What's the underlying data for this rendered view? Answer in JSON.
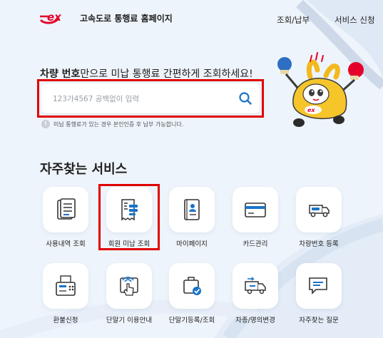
{
  "header": {
    "site_title": "고속도로 통행료 홈페이지",
    "nav": [
      "조회/납부",
      "서비스 신청"
    ]
  },
  "search": {
    "headline_bold": "차량 번호",
    "headline_rest": "만으로 미납 통행료 간편하게 조회하세요!",
    "placeholder": "123가4567 공백없이 입력",
    "notice": "미납 통행료가 있는 경우 본인인증 후 납부 가능합니다."
  },
  "services": {
    "title": "자주찾는 서비스",
    "items": [
      {
        "label": "사용내역 조회",
        "icon": "document-list-icon"
      },
      {
        "label": "회원 미납 조회",
        "icon": "receipt-icon"
      },
      {
        "label": "마이페이지",
        "icon": "profile-book-icon"
      },
      {
        "label": "카드관리",
        "icon": "credit-card-icon"
      },
      {
        "label": "차량번호 등록",
        "icon": "vehicle-icon"
      },
      {
        "label": "환불신청",
        "icon": "fax-machine-icon"
      },
      {
        "label": "단말기 이용안내",
        "icon": "tap-terminal-icon"
      },
      {
        "label": "단말기등록/조회",
        "icon": "terminal-check-icon"
      },
      {
        "label": "차종/명의변경",
        "icon": "truck-swap-icon"
      },
      {
        "label": "자주찾는 질문",
        "icon": "chat-bubble-icon"
      }
    ]
  },
  "colors": {
    "brand_red": "#e4002b",
    "accent_blue": "#1a73c8",
    "highlight_red": "#e00000"
  }
}
